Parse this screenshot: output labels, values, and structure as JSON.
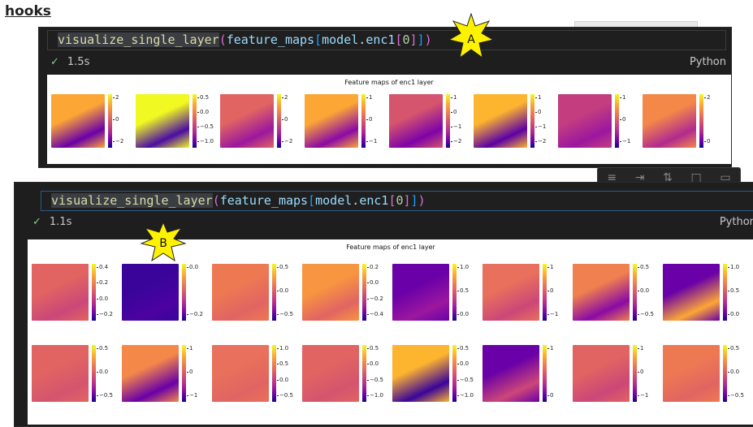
{
  "heading": "hooks",
  "cell_a": {
    "code": {
      "fn": "visualize_single_layer",
      "open1": "(",
      "arg": "feature_maps",
      "open2": "[",
      "obj": "model",
      "dot": ".",
      "attr": "enc1",
      "open3": "[",
      "idx": "0",
      "close3": "]",
      "close2": "]",
      "close1": ")"
    },
    "status_time": "1.5s",
    "language": "Python",
    "plot_title": "Feature maps of enc1 layer",
    "callout": "A",
    "panels": [
      {
        "ticks": [
          "2",
          "0",
          "−2"
        ],
        "c1": "#fca636",
        "c2": "#6a00a8"
      },
      {
        "ticks": [
          "0.5",
          "0.0",
          "−0.5",
          "−1.0"
        ],
        "c1": "#f0f921",
        "c2": "#4b0ca3"
      },
      {
        "ticks": [
          "2",
          "0",
          "−2"
        ],
        "c1": "#e16462",
        "c2": "#9c179e"
      },
      {
        "ticks": [
          "1",
          "0",
          "−1"
        ],
        "c1": "#fca636",
        "c2": "#8b0aa5"
      },
      {
        "ticks": [
          "1",
          "0",
          "−1",
          "−2"
        ],
        "c1": "#d5546e",
        "c2": "#7e03a8"
      },
      {
        "ticks": [
          "1",
          "0",
          "−1",
          "−2"
        ],
        "c1": "#fdb42f",
        "c2": "#5c01a6"
      },
      {
        "ticks": [
          "1",
          "0",
          "−1"
        ],
        "c1": "#c43e7f",
        "c2": "#9c179e"
      },
      {
        "ticks": [
          "2",
          "0"
        ],
        "c1": "#f48849",
        "c2": "#b12a90"
      }
    ]
  },
  "cell_b": {
    "code": {
      "fn": "visualize_single_layer",
      "open1": "(",
      "arg": "feature_maps",
      "open2": "[",
      "obj": "model",
      "dot": ".",
      "attr": "enc1",
      "open3": "[",
      "idx": "0",
      "close3": "]",
      "close2": "]",
      "close1": ")"
    },
    "status_time": "1.1s",
    "language": "Pythor",
    "plot_title": "Feature maps of enc1 layer",
    "callout": "B",
    "toolbar_icons": [
      "split-icon",
      "run-below-icon",
      "sort-icon",
      "square-icon",
      "delete-icon"
    ],
    "panels_row1": [
      {
        "ticks": [
          "0.4",
          "0.2",
          "0.0",
          "−0.2"
        ],
        "c1": "#e16462",
        "c2": "#cc4778"
      },
      {
        "ticks": [
          "0.0",
          "−0.2"
        ],
        "c1": "#3a049a",
        "c2": "#4c02a1"
      },
      {
        "ticks": [
          "0.5",
          "0.0",
          "−0.5"
        ],
        "c1": "#ed7953",
        "c2": "#e16462"
      },
      {
        "ticks": [
          "0.2",
          "0.0",
          "−0.2",
          "−0.4"
        ],
        "c1": "#f89540",
        "c2": "#e16462"
      },
      {
        "ticks": [
          "1.0",
          "0.5",
          "0.0"
        ],
        "c1": "#6a00a8",
        "c2": "#9c179e"
      },
      {
        "ticks": [
          "1",
          "0",
          "−1"
        ],
        "c1": "#e8705c",
        "c2": "#cc4778"
      },
      {
        "ticks": [
          "0.5",
          "0.0",
          "−0.5"
        ],
        "c1": "#f0804f",
        "c2": "#8b0aa5"
      },
      {
        "ticks": [
          "1.0",
          "0.5",
          "0.0"
        ],
        "c1": "#6a00a8",
        "c2": "#fca636"
      }
    ],
    "panels_row2": [
      {
        "ticks": [
          "0.5",
          "0.0",
          "−0.5"
        ],
        "c1": "#e16462",
        "c2": "#d5546e"
      },
      {
        "ticks": [
          "1",
          "0",
          "−1"
        ],
        "c1": "#f48849",
        "c2": "#6a00a8"
      },
      {
        "ticks": [
          "1.0",
          "0.5",
          "0.0",
          "−0.5"
        ],
        "c1": "#e8705c",
        "c2": "#e16462"
      },
      {
        "ticks": [
          "0.5",
          "0.0",
          "−0.5",
          "−1.0"
        ],
        "c1": "#e16462",
        "c2": "#d5546e"
      },
      {
        "ticks": [
          "0.5",
          "0.0",
          "−0.5",
          "−1.0"
        ],
        "c1": "#fdb42f",
        "c2": "#3a049a"
      },
      {
        "ticks": [
          "1",
          "0"
        ],
        "c1": "#6a00a8",
        "c2": "#cc4778"
      },
      {
        "ticks": [
          "1",
          "0",
          "−1"
        ],
        "c1": "#e16462",
        "c2": "#cc4778"
      },
      {
        "ticks": [
          "0.5",
          "0.0",
          "−0.5"
        ],
        "c1": "#ed7953",
        "c2": "#e16462"
      }
    ]
  }
}
